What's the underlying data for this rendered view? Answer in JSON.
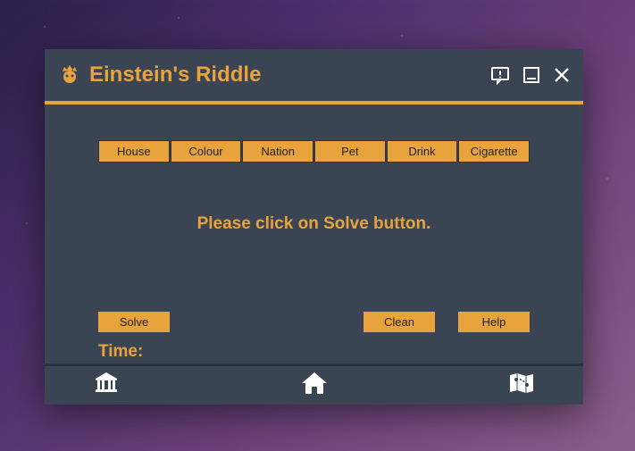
{
  "app": {
    "title": "Einstein's Riddle"
  },
  "columns": [
    {
      "label": "House"
    },
    {
      "label": "Colour"
    },
    {
      "label": "Nation"
    },
    {
      "label": "Pet"
    },
    {
      "label": "Drink"
    },
    {
      "label": "Cigarette"
    }
  ],
  "instruction": "Please click on Solve button.",
  "buttons": {
    "solve": "Solve",
    "clean": "Clean",
    "help": "Help"
  },
  "time_label": "Time:",
  "colors": {
    "accent": "#e8a33d",
    "panel": "#3b4452"
  }
}
